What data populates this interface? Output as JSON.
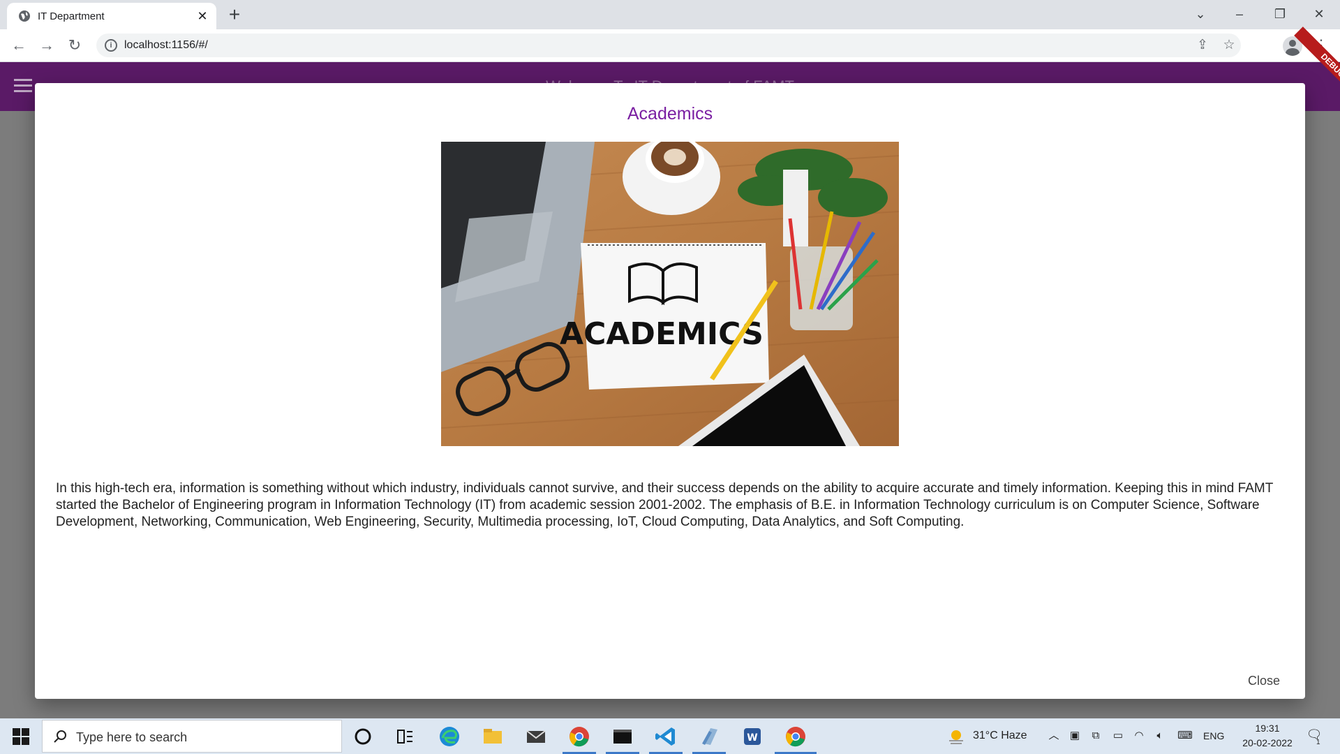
{
  "browser": {
    "tab_title": "IT Department",
    "url": "localhost:1156/#/"
  },
  "app": {
    "appbar_title": "Welcome To IT Department of FAMT",
    "debug_label": "DEBUG"
  },
  "dialog": {
    "title": "Academics",
    "image_text": "ACADEMICS",
    "body": "In this high-tech era, information is something without which industry, individuals cannot survive, and their success depends on the ability to acquire accurate and timely information. Keeping this in mind FAMT started the Bachelor of Engineering program in Information Technology (IT) from academic session 2001-2002. The emphasis of B.E. in Information Technology curriculum is on Computer Science, Software Development, Networking, Communication, Web Engineering, Security, Multimedia processing, IoT, Cloud Computing, Data Analytics, and Soft Computing.",
    "close_label": "Close"
  },
  "taskbar": {
    "search_placeholder": "Type here to search",
    "weather": "31°C  Haze",
    "language": "ENG",
    "time": "19:31",
    "date": "20-02-2022",
    "notification_count": "1"
  },
  "colors": {
    "appbar": "#5a1a66",
    "dialog_title": "#7a1fa2",
    "debug_banner": "#b71c1c"
  }
}
